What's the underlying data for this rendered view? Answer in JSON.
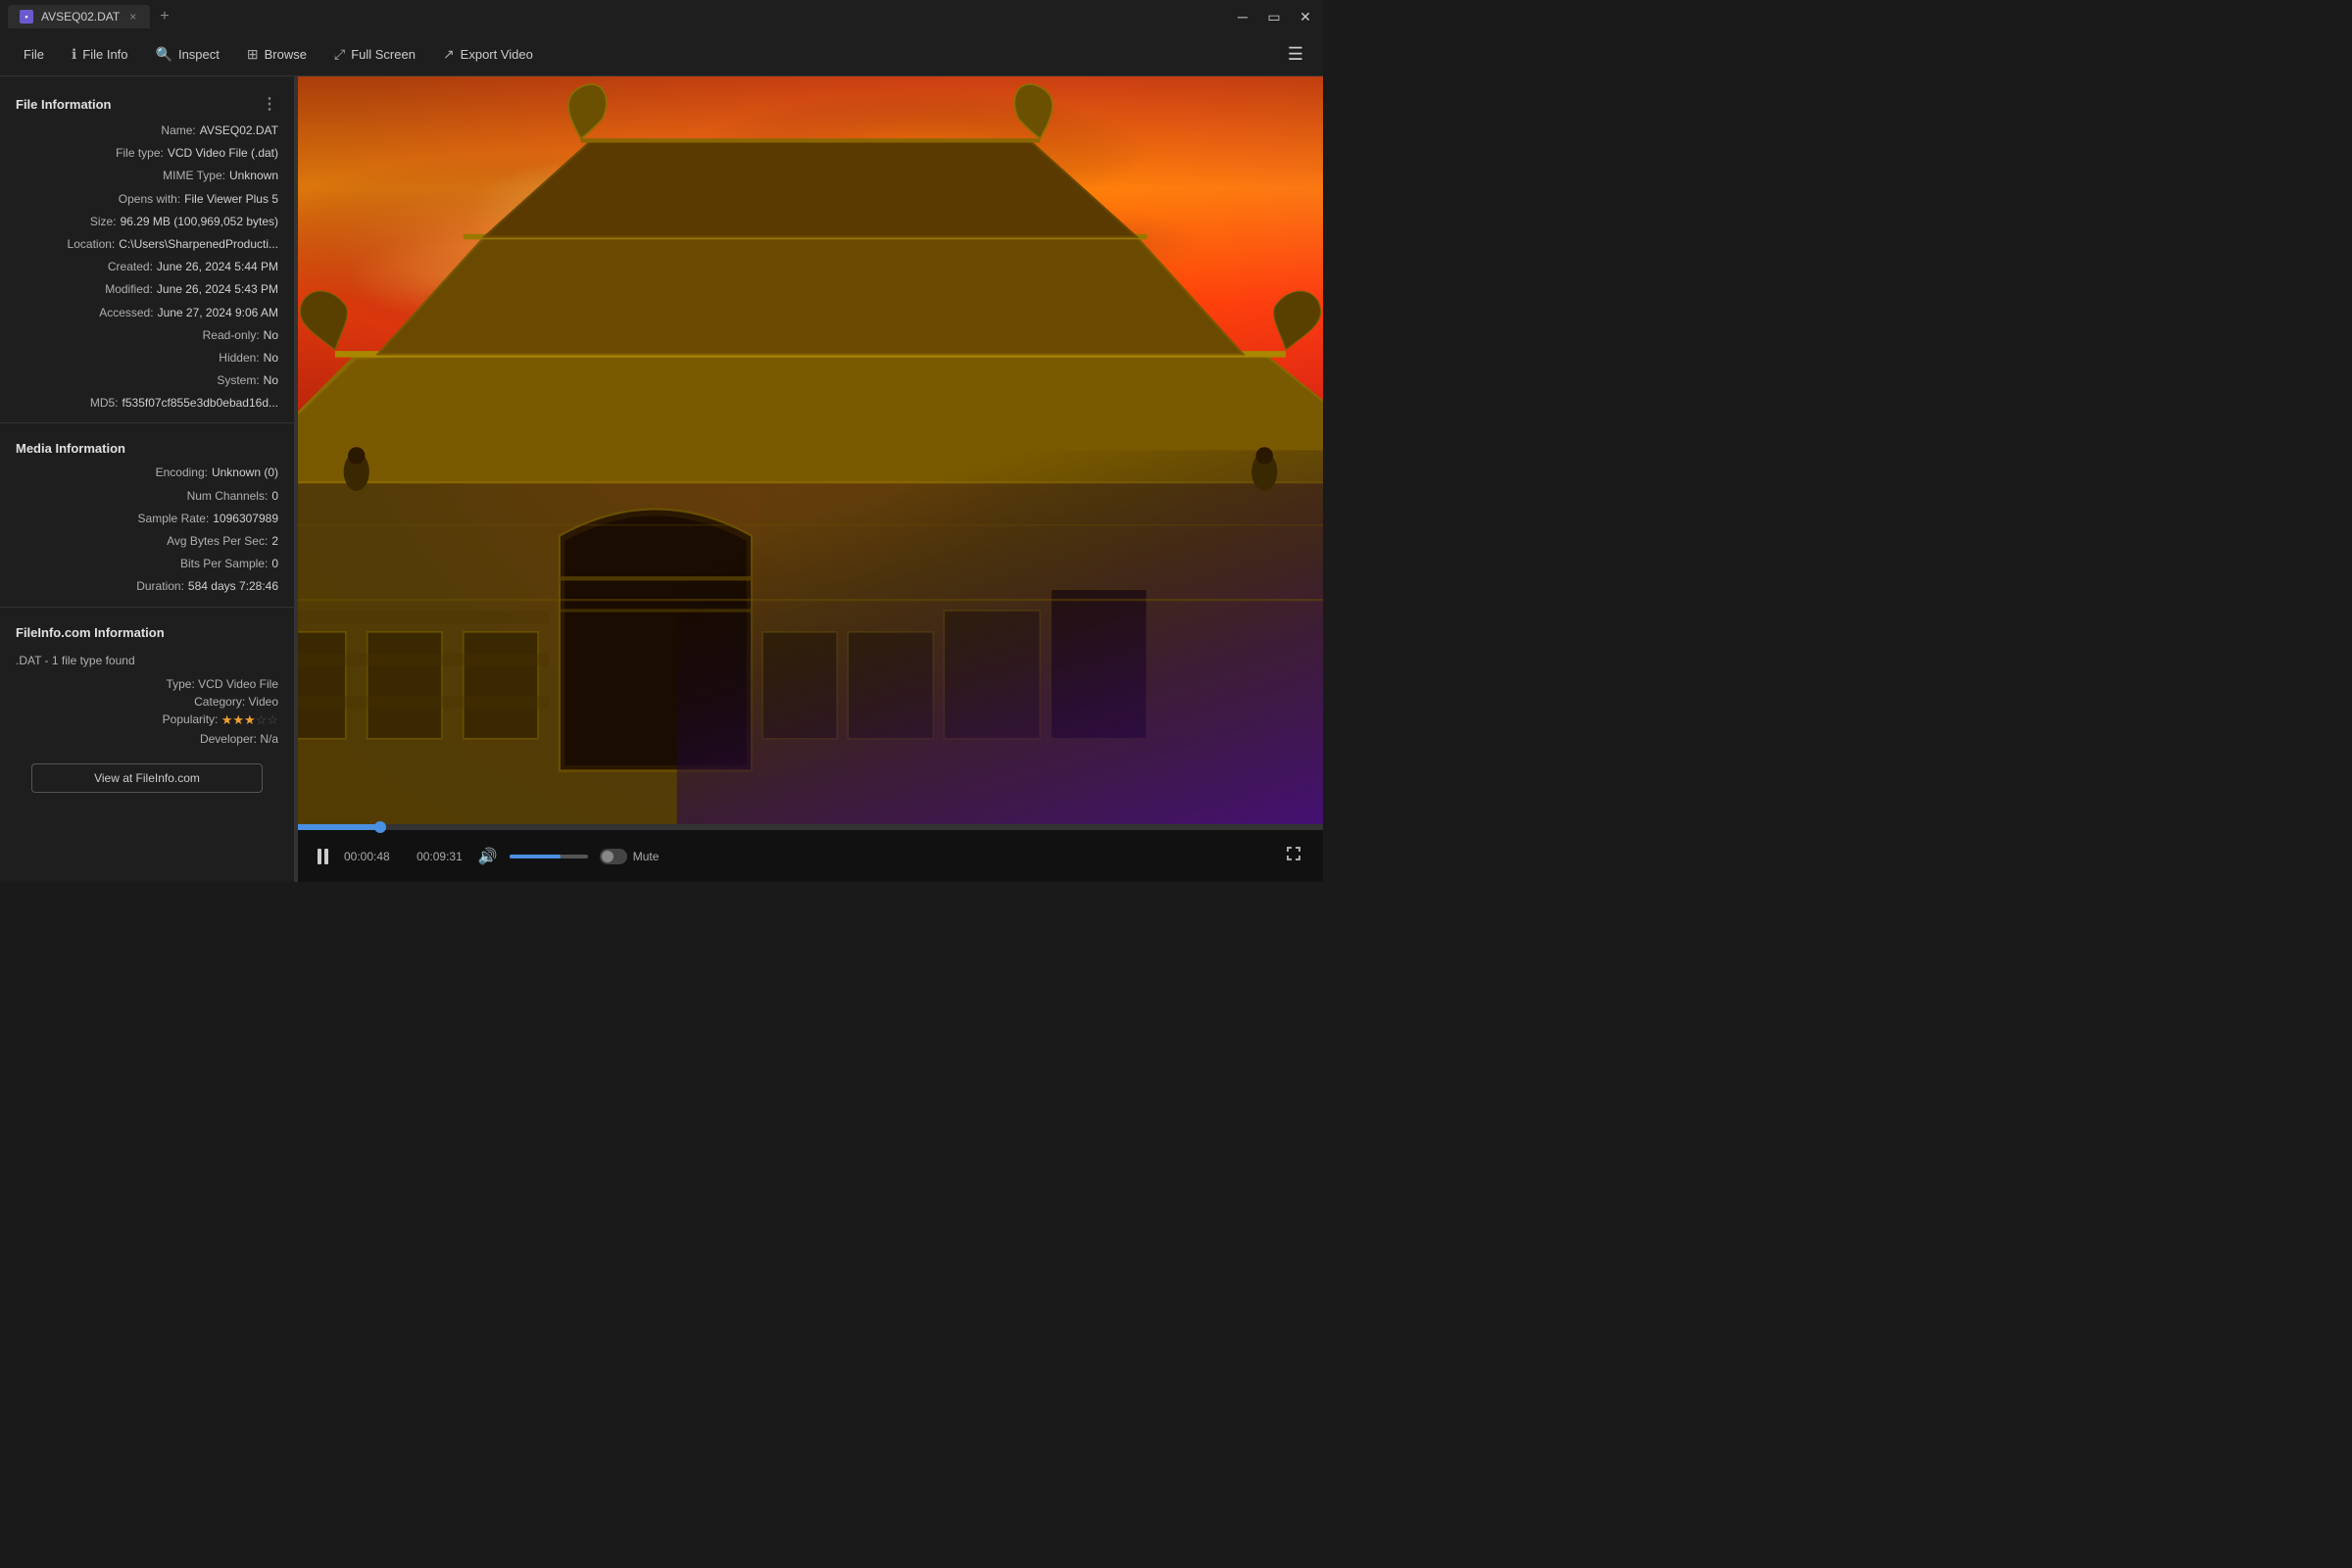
{
  "titlebar": {
    "tab_name": "AVSEQ02.DAT",
    "tab_icon": "▪",
    "close_label": "×",
    "add_label": "+",
    "minimize_label": "─",
    "maximize_label": "▭",
    "close_win_label": "✕"
  },
  "menubar": {
    "file_label": "File",
    "file_info_label": "File Info",
    "inspect_label": "Inspect",
    "browse_label": "Browse",
    "fullscreen_label": "Full Screen",
    "export_label": "Export Video",
    "hamburger_label": "☰"
  },
  "file_info": {
    "section_title": "File Information",
    "name_label": "Name:",
    "name_value": "AVSEQ02.DAT",
    "filetype_label": "File type:",
    "filetype_value": "VCD Video File (.dat)",
    "mime_label": "MIME Type:",
    "mime_value": "Unknown",
    "opens_label": "Opens with:",
    "opens_value": "File Viewer Plus 5",
    "size_label": "Size:",
    "size_value": "96.29 MB (100,969,052 bytes)",
    "location_label": "Location:",
    "location_value": "C:\\Users\\SharpenedProducti...",
    "created_label": "Created:",
    "created_value": "June 26, 2024 5:44 PM",
    "modified_label": "Modified:",
    "modified_value": "June 26, 2024 5:43 PM",
    "accessed_label": "Accessed:",
    "accessed_value": "June 27, 2024 9:06 AM",
    "readonly_label": "Read-only:",
    "readonly_value": "No",
    "hidden_label": "Hidden:",
    "hidden_value": "No",
    "system_label": "System:",
    "system_value": "No",
    "md5_label": "MD5:",
    "md5_value": "f535f07cf855e3db0ebad16d..."
  },
  "media_info": {
    "section_title": "Media Information",
    "encoding_label": "Encoding:",
    "encoding_value": "Unknown (0)",
    "channels_label": "Num Channels:",
    "channels_value": "0",
    "samplerate_label": "Sample Rate:",
    "samplerate_value": "1096307989",
    "avgbytes_label": "Avg Bytes Per Sec:",
    "avgbytes_value": "2",
    "bitspersample_label": "Bits Per Sample:",
    "bitspersample_value": "0",
    "duration_label": "Duration:",
    "duration_value": "584 days 7:28:46"
  },
  "fileinfo_com": {
    "section_title": "FileInfo.com Information",
    "subtitle": ".DAT - 1 file type found",
    "type_label": "Type:",
    "type_value": "VCD Video File",
    "category_label": "Category:",
    "category_value": "Video",
    "popularity_label": "Popularity:",
    "developer_label": "Developer:",
    "developer_value": "N/a",
    "view_btn_label": "View at FileInfo.com"
  },
  "video_controls": {
    "current_time": "00:00:48",
    "total_time": "00:09:31",
    "mute_label": "Mute",
    "progress_percent": 8,
    "volume_percent": 65
  },
  "colors": {
    "accent": "#4a90e2",
    "bg_dark": "#1e1e1e",
    "text_primary": "#e0e0e0",
    "text_secondary": "#b0b0b0"
  }
}
